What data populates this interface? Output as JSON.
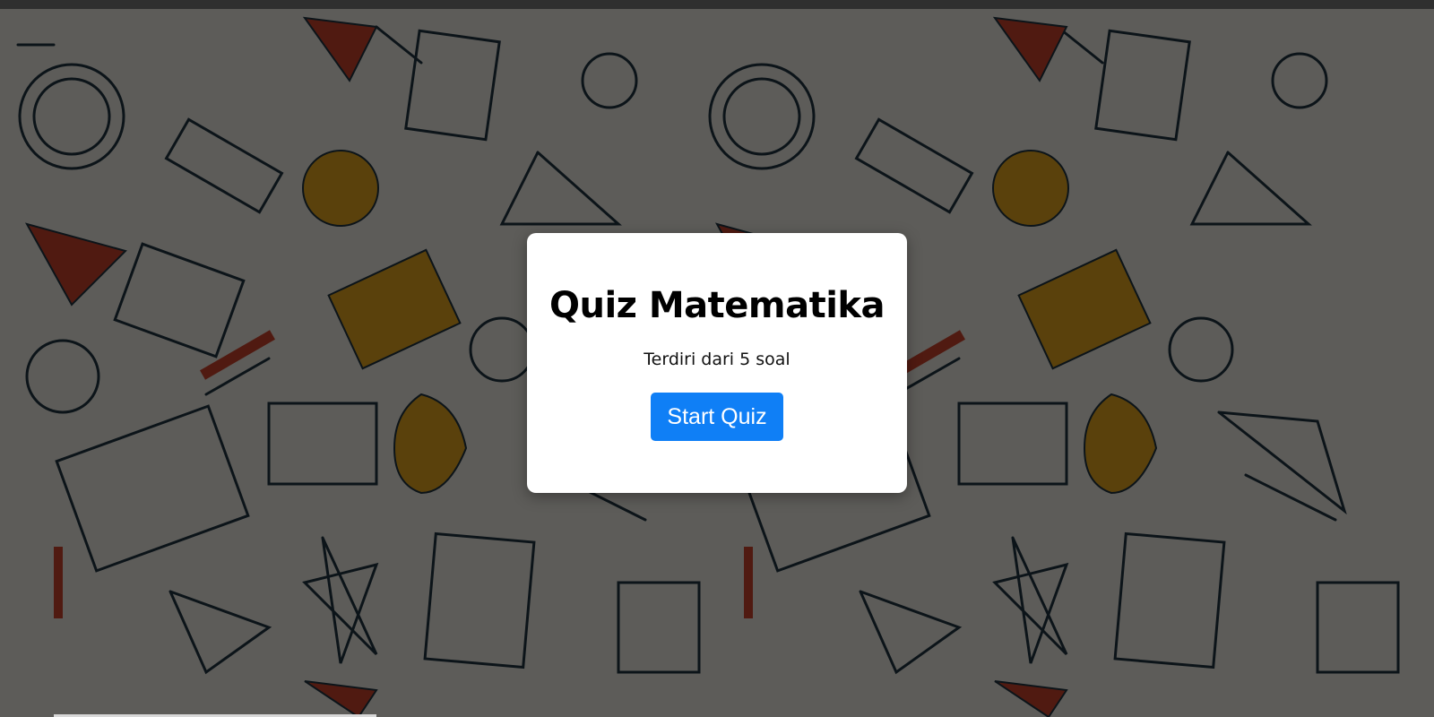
{
  "quiz": {
    "title": "Quiz Matematika",
    "subtitle": "Terdiri dari 5 soal",
    "start_label": "Start Quiz"
  },
  "colors": {
    "button": "#0f7ff6",
    "card": "#ffffff",
    "overlay": "rgba(0,0,0,0.6)",
    "doodle_dark": "#1f3340",
    "doodle_red": "#c8432b",
    "doodle_yellow": "#e0a21e"
  },
  "background": {
    "pattern": "math-doodle-pattern"
  }
}
